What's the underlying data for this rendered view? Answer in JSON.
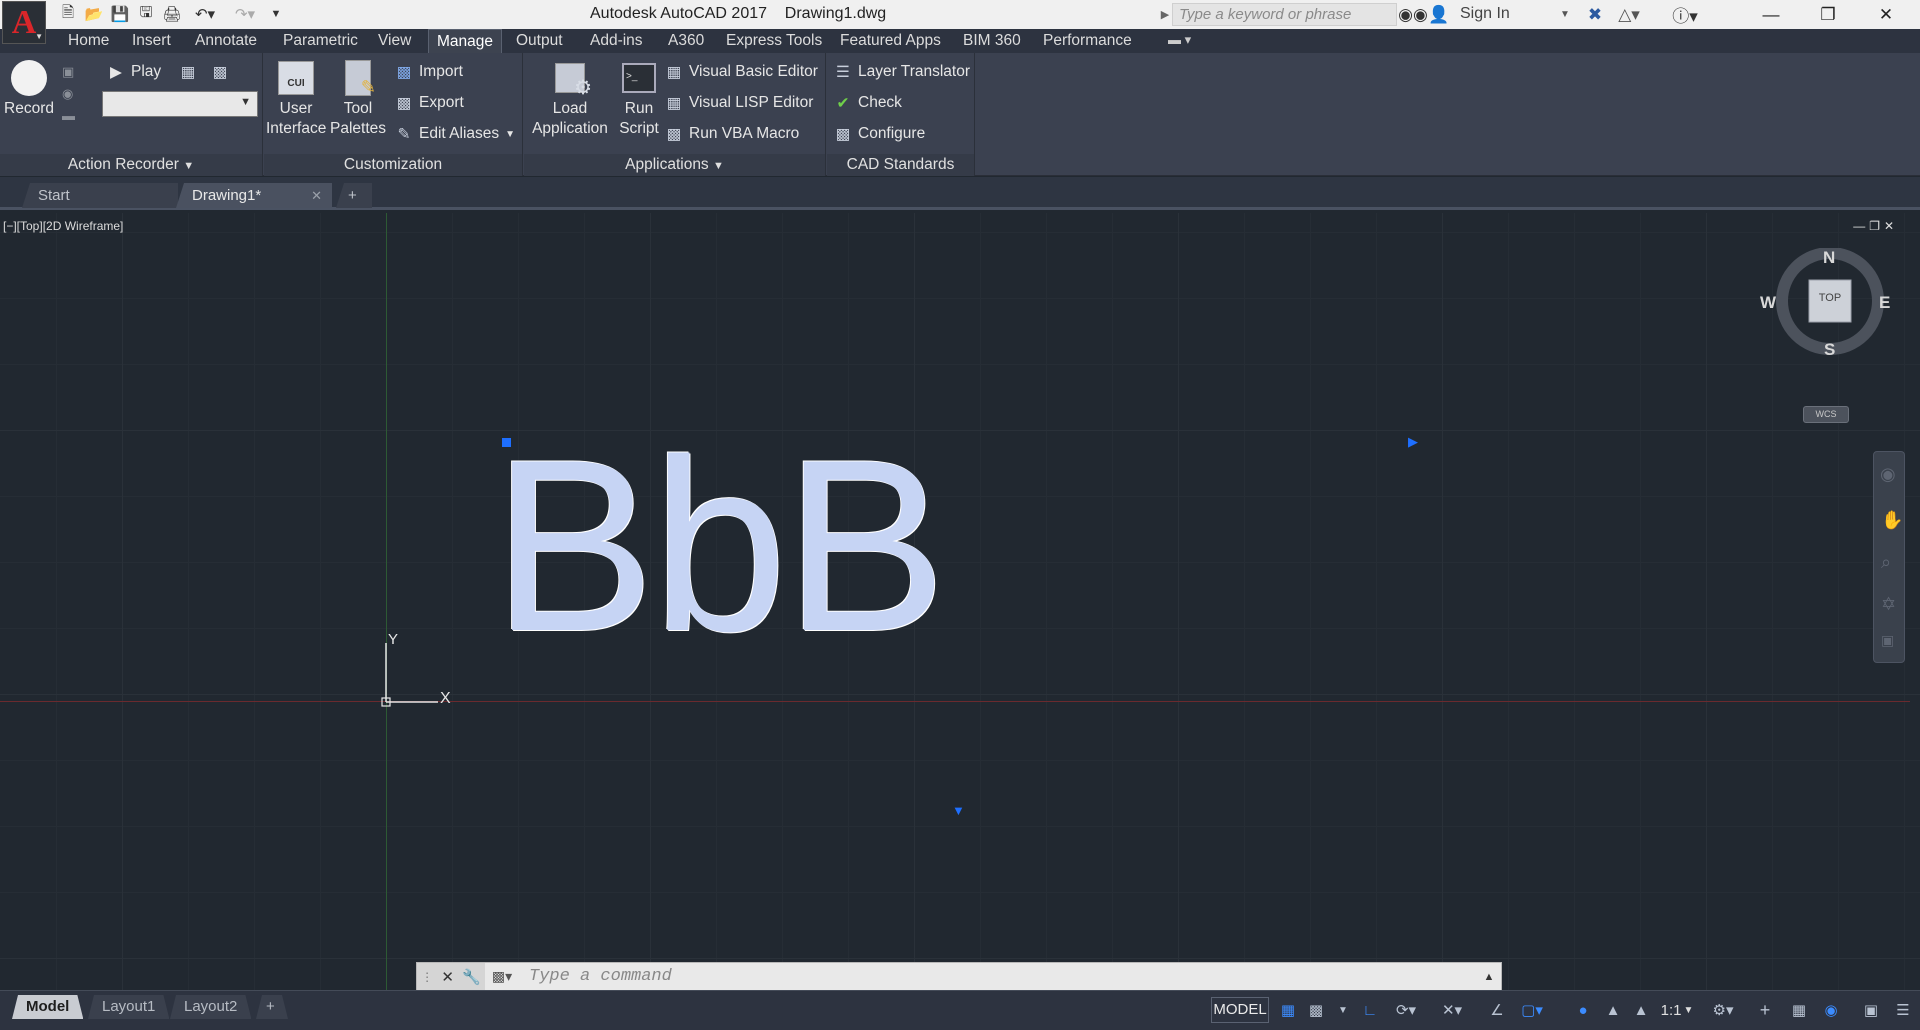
{
  "titlebar": {
    "app_name": "Autodesk AutoCAD 2017",
    "document": "Drawing1.dwg",
    "search_placeholder": "Type a keyword or phrase",
    "signin": "Sign In",
    "logo_letter": "A"
  },
  "ribbon_tabs": [
    "Home",
    "Insert",
    "Annotate",
    "Parametric",
    "View",
    "Manage",
    "Output",
    "Add-ins",
    "A360",
    "Express Tools",
    "Featured Apps",
    "BIM 360",
    "Performance"
  ],
  "active_tab": "Manage",
  "panels": {
    "action_recorder": {
      "title": "Action Recorder",
      "record": "Record",
      "play": "Play"
    },
    "customization": {
      "title": "Customization",
      "user_interface": [
        "User",
        "Interface"
      ],
      "tool_palettes": [
        "Tool",
        "Palettes"
      ],
      "import": "Import",
      "export": "Export",
      "edit_aliases": "Edit Aliases"
    },
    "applications": {
      "title": "Applications",
      "load_application": [
        "Load",
        "Application"
      ],
      "run_script": [
        "Run",
        "Script"
      ],
      "vbe": "Visual Basic Editor",
      "vlisp": "Visual LISP Editor",
      "run_vba": "Run VBA Macro"
    },
    "cad_standards": {
      "title": "CAD Standards",
      "layer_translator": "Layer Translator",
      "check": "Check",
      "configure": "Configure"
    }
  },
  "doc_tabs": [
    {
      "label": "Start"
    },
    {
      "label": "Drawing1*"
    }
  ],
  "viewport": {
    "label": "[−][Top][2D Wireframe]",
    "text_object": "BbB",
    "ucs_x": "X",
    "ucs_y": "Y"
  },
  "viewcube": {
    "n": "N",
    "s": "S",
    "e": "E",
    "w": "W",
    "face": "TOP",
    "wcs": "WCS"
  },
  "command_line": {
    "placeholder": "Type a command"
  },
  "layout_tabs": [
    "Model",
    "Layout1",
    "Layout2"
  ],
  "status": {
    "model": "MODEL",
    "scale": "1:1"
  }
}
